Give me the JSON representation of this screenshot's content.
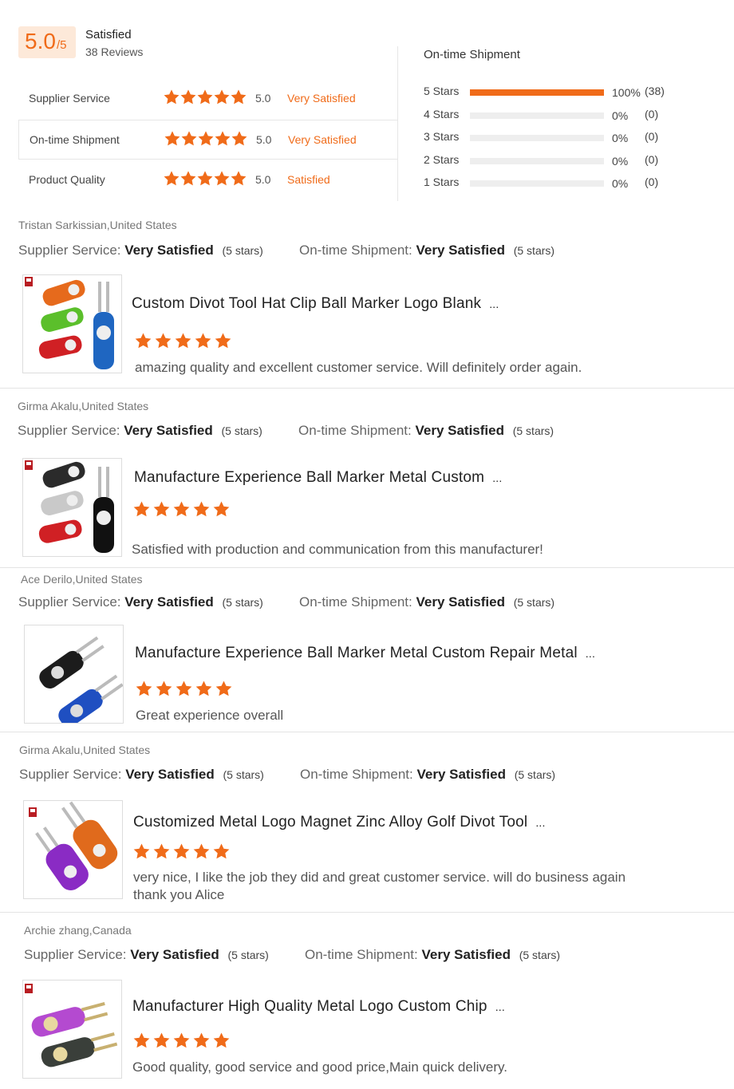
{
  "summary": {
    "score": "5.0",
    "score_max": "/5",
    "overall_label": "Satisfied",
    "review_count": "38 Reviews",
    "categories": [
      {
        "name": "Supplier Service",
        "score": "5.0",
        "level": "Very Satisfied",
        "stars": 5
      },
      {
        "name": "On-time Shipment",
        "score": "5.0",
        "level": "Very Satisfied",
        "stars": 5
      },
      {
        "name": "Product Quality",
        "score": "5.0",
        "level": "Satisfied",
        "stars": 5
      }
    ],
    "shipment_title": "On-time Shipment",
    "distribution": [
      {
        "label": "5  Stars",
        "percent_text": "100%",
        "count": "(38)",
        "fraction": 1.0
      },
      {
        "label": "4  Stars",
        "percent_text": "0%",
        "count": "(0)",
        "fraction": 0
      },
      {
        "label": "3  Stars",
        "percent_text": "0%",
        "count": "(0)",
        "fraction": 0
      },
      {
        "label": "2  Stars",
        "percent_text": "0%",
        "count": "(0)",
        "fraction": 0
      },
      {
        "label": "1  Stars",
        "percent_text": "0%",
        "count": "(0)",
        "fraction": 0
      }
    ]
  },
  "colors": {
    "accent": "#f06b19",
    "bar_bg": "#eeeeee"
  },
  "rating_labels": {
    "supplier": "Supplier Service:",
    "shipment": "On-time Shipment:",
    "value": "Very Satisfied",
    "stars_text": "(5 stars)"
  },
  "reviews": [
    {
      "reviewer": "Tristan Sarkissian,United States",
      "product": "Custom Divot Tool Hat Clip Ball Marker Logo Blank",
      "ellipsis": "...",
      "rating": 5,
      "text": "amazing quality and excellent customer service. Will definitely order again.",
      "image": "golf-divot-tool-image"
    },
    {
      "reviewer": "Girma Akalu,United States",
      "product": "Manufacture Experience Ball Marker Metal Custom",
      "ellipsis": "...",
      "rating": 5,
      "text": "Satisfied with production and communication from this manufacturer!",
      "image": "golf-divot-tool-image"
    },
    {
      "reviewer": "Ace Derilo,United States",
      "product": "Manufacture Experience Ball Marker Metal Custom Repair Metal",
      "ellipsis": "...",
      "rating": 5,
      "text": "Great experience overall",
      "image": "golf-divot-tool-image"
    },
    {
      "reviewer": "Girma Akalu,United States",
      "product": "Customized Metal Logo Magnet Zinc Alloy Golf Divot Tool",
      "ellipsis": "...",
      "rating": 5,
      "text": "very nice, I like the job they did and great customer service. will do business again thank you Alice",
      "image": "golf-divot-tool-image"
    },
    {
      "reviewer": "Archie zhang,Canada",
      "product": "Manufacturer High Quality Metal Logo Custom Chip",
      "ellipsis": "...",
      "rating": 5,
      "text": "Good quality, good service and good price,Main quick delivery.",
      "image": "golf-divot-tool-image"
    }
  ]
}
